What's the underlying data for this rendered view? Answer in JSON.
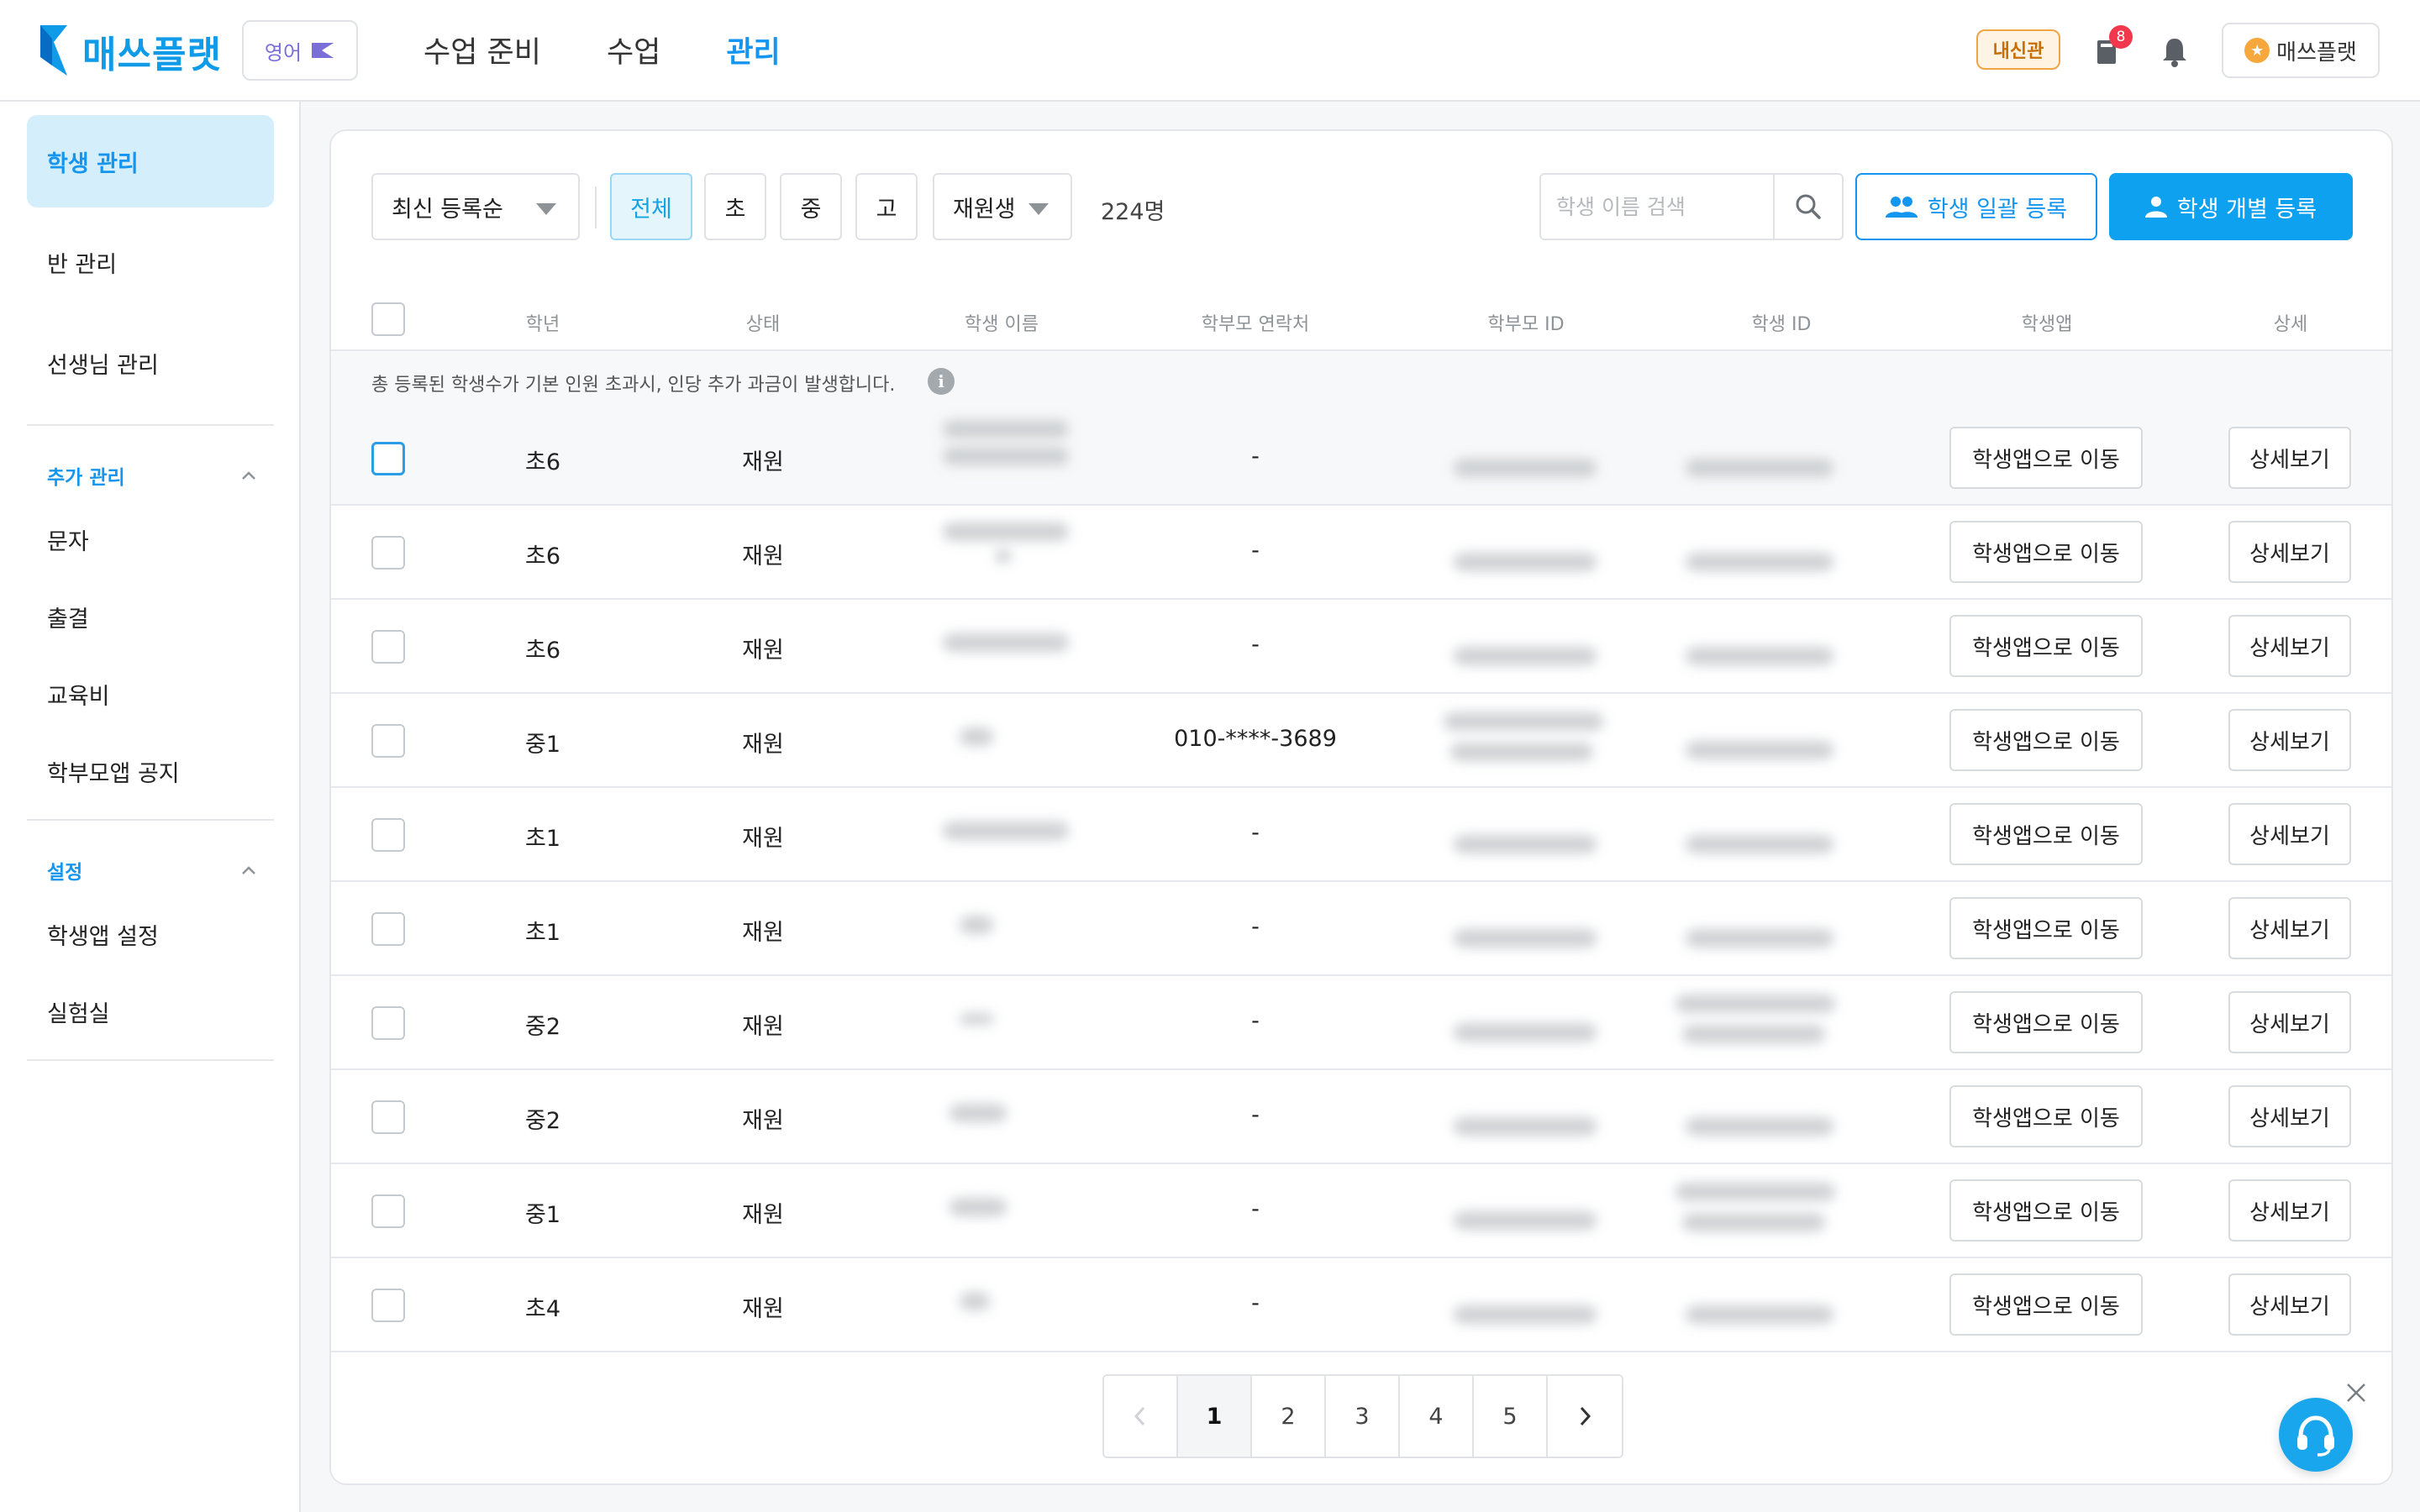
{
  "header": {
    "logo_text": "매쓰플랫",
    "lang_label": "영어",
    "nav": [
      {
        "label": "수업 준비",
        "active": false
      },
      {
        "label": "수업",
        "active": false
      },
      {
        "label": "관리",
        "active": true
      }
    ],
    "school_badge": "내신관",
    "notification_count": "8",
    "profile_name": "매쓰플랫"
  },
  "sidebar": {
    "items": [
      {
        "label": "학생 관리",
        "active": true
      },
      {
        "label": "반 관리",
        "active": false
      },
      {
        "label": "선생님 관리",
        "active": false
      }
    ],
    "section_extra": {
      "title": "추가 관리",
      "items": [
        "문자",
        "출결",
        "교육비",
        "학부모앱 공지"
      ]
    },
    "section_settings": {
      "title": "설정",
      "items": [
        "학생앱 설정",
        "실험실"
      ]
    }
  },
  "toolbar": {
    "sort_value": "최신 등록순",
    "level_chips": [
      {
        "label": "전체",
        "active": true
      },
      {
        "label": "초",
        "active": false
      },
      {
        "label": "중",
        "active": false
      },
      {
        "label": "고",
        "active": false
      }
    ],
    "status_value": "재원생",
    "count": "224명",
    "search_placeholder": "학생 이름 검색",
    "bulk_register": "학생 일괄 등록",
    "single_register": "학생 개별 등록"
  },
  "table": {
    "headers": [
      "학년",
      "상태",
      "학생 이름",
      "학부모 연락처",
      "학부모 ID",
      "학생 ID",
      "학생앱",
      "상세"
    ],
    "notice": "총 등록된 학생수가 기본 인원 초과시, 인당 추가 과금이 발생합니다.",
    "app_button": "학생앱으로 이동",
    "detail_button": "상세보기",
    "rows": [
      {
        "grade": "초6",
        "status": "재원",
        "parent_phone": "-"
      },
      {
        "grade": "초6",
        "status": "재원",
        "parent_phone": "-"
      },
      {
        "grade": "초6",
        "status": "재원",
        "parent_phone": "-"
      },
      {
        "grade": "중1",
        "status": "재원",
        "parent_phone": "010-****-3689"
      },
      {
        "grade": "초1",
        "status": "재원",
        "parent_phone": "-"
      },
      {
        "grade": "초1",
        "status": "재원",
        "parent_phone": "-"
      },
      {
        "grade": "중2",
        "status": "재원",
        "parent_phone": "-"
      },
      {
        "grade": "중2",
        "status": "재원",
        "parent_phone": "-"
      },
      {
        "grade": "중1",
        "status": "재원",
        "parent_phone": "-"
      },
      {
        "grade": "초4",
        "status": "재원",
        "parent_phone": "-"
      }
    ]
  },
  "pagination": {
    "pages": [
      "1",
      "2",
      "3",
      "4",
      "5"
    ],
    "current": "1"
  },
  "colors": {
    "brand": "#0f9be8",
    "primary_button": "#0ea1f0",
    "active_sidebar_bg": "#d5eefc",
    "badge_orange": "#f0a545",
    "notification_red": "#f2384c"
  }
}
